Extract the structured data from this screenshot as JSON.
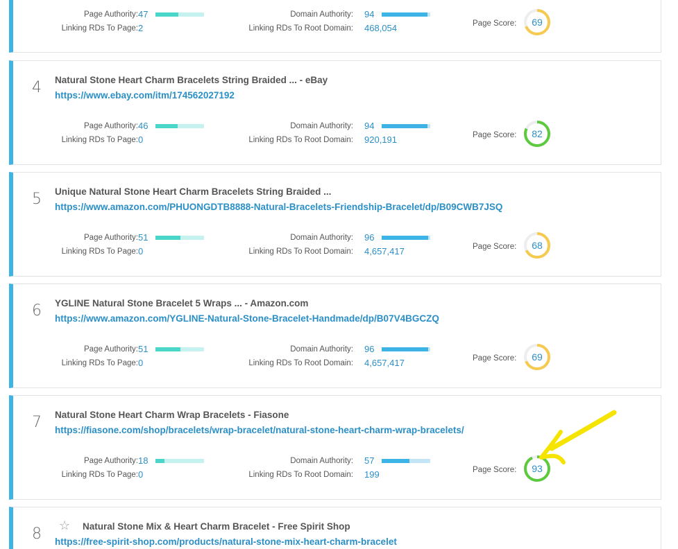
{
  "labels": {
    "page_authority": "Page Authority:",
    "linking_rds_page": "Linking RDs To Page:",
    "domain_authority": "Domain Authority:",
    "linking_rds_root": "Linking RDs To Root Domain:",
    "page_score": "Page Score:"
  },
  "results": [
    {
      "rank": "",
      "title": "",
      "url": "",
      "page_authority": "47",
      "linking_rds_page": "2",
      "domain_authority": "94",
      "linking_rds_root": "468,054",
      "page_score": "69",
      "score_color": "#f6c94f",
      "pa_fraction": 0.47,
      "da_fraction": 0.94
    },
    {
      "rank": "4",
      "title": "Natural Stone Heart Charm Bracelets String Braided ... - eBay",
      "url": "https://www.ebay.com/itm/174562027192",
      "page_authority": "46",
      "linking_rds_page": "0",
      "domain_authority": "94",
      "linking_rds_root": "920,191",
      "page_score": "82",
      "score_color": "#5cc93f",
      "pa_fraction": 0.46,
      "da_fraction": 0.94
    },
    {
      "rank": "5",
      "title": "Unique Natural Stone Heart Charm Bracelets String Braided ...",
      "url": "https://www.amazon.com/PHUONGDTB8888-Natural-Bracelets-Friendship-Bracelet/dp/B09CWB7JSQ",
      "page_authority": "51",
      "linking_rds_page": "0",
      "domain_authority": "96",
      "linking_rds_root": "4,657,417",
      "page_score": "68",
      "score_color": "#f6c94f",
      "pa_fraction": 0.51,
      "da_fraction": 0.96
    },
    {
      "rank": "6",
      "title": "YGLINE Natural Stone Bracelet 5 Wraps ... - Amazon.com",
      "url": "https://www.amazon.com/YGLINE-Natural-Stone-Bracelet-Handmade/dp/B07V4BGCZQ",
      "page_authority": "51",
      "linking_rds_page": "0",
      "domain_authority": "96",
      "linking_rds_root": "4,657,417",
      "page_score": "69",
      "score_color": "#f6c94f",
      "pa_fraction": 0.51,
      "da_fraction": 0.96
    },
    {
      "rank": "7",
      "title": "Natural Stone Heart Charm Wrap Bracelets - Fiasone",
      "url": "https://fiasone.com/shop/bracelets/wrap-bracelet/natural-stone-heart-charm-wrap-bracelets/",
      "page_authority": "18",
      "linking_rds_page": "0",
      "domain_authority": "57",
      "linking_rds_root": "199",
      "page_score": "93",
      "score_color": "#5cc93f",
      "pa_fraction": 0.18,
      "da_fraction": 0.57
    },
    {
      "rank": "8",
      "title": "Natural Stone Mix & Heart Charm Bracelet - Free Spirit Shop",
      "url": "https://free-spirit-shop.com/products/natural-stone-mix-heart-charm-bracelet"
    }
  ],
  "colors": {
    "accent": "#3db3e6",
    "link": "#2b8fc7",
    "pa_bar": "#4ad6c8",
    "annotation_arrow": "#f5e400"
  },
  "icons": {
    "star": "star-icon",
    "annotation": "arrow-annotation-icon"
  }
}
